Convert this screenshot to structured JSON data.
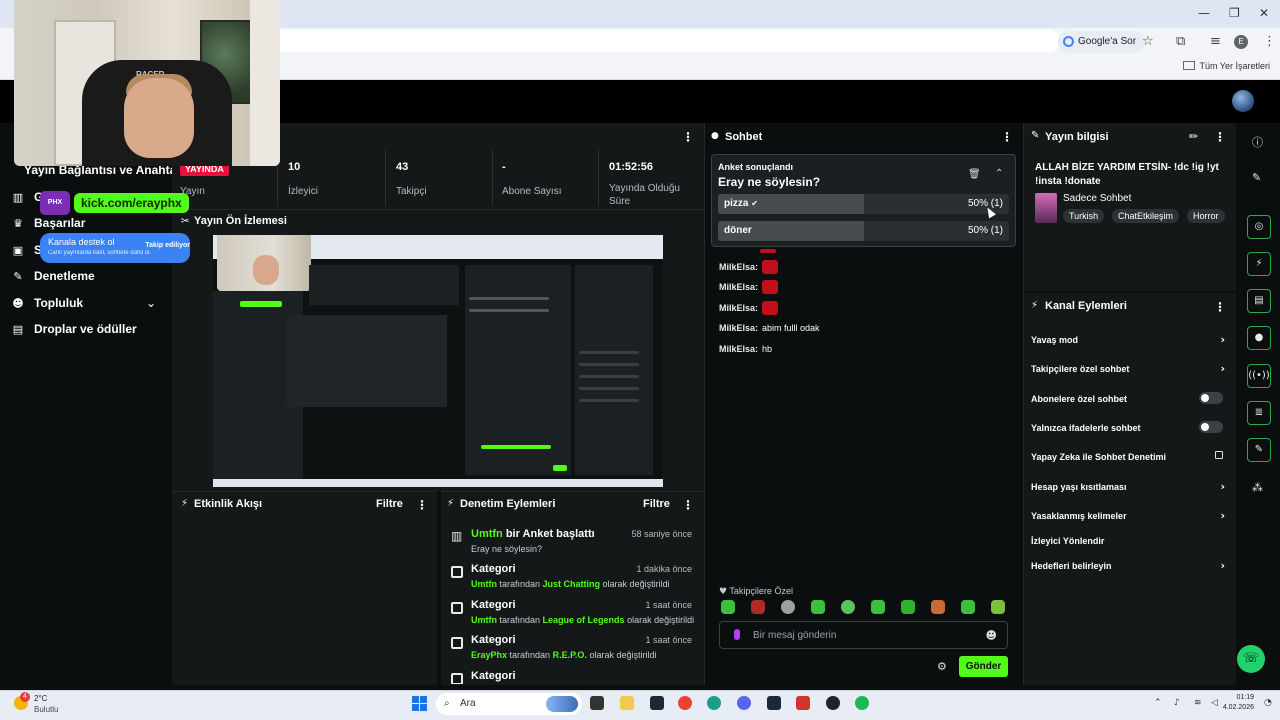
{
  "browser": {
    "google_pill": "Google'a Sor",
    "bookmarks_label": "Tüm Yer İşaretleri",
    "profile_initial": "E"
  },
  "webcam_overlay": {
    "chair_brand": "RACER",
    "kick_badge": "PHX",
    "kick_link": "kick.com/erayphx",
    "support_title": "Kanala destek ol",
    "support_sub": "Canlı yayınlarda katıl, sohbete dahil ol.",
    "support_action": "Takip ediliyor"
  },
  "sidebar": {
    "items": [
      {
        "label": "Yayın Bağlantısı ve Anahtarı",
        "icon": "key-icon"
      },
      {
        "label": "G",
        "icon": "chart-icon"
      },
      {
        "label": "Başarılar",
        "icon": "trophy-icon"
      },
      {
        "label": "S",
        "icon": "video-icon"
      },
      {
        "label": "Denetleme",
        "icon": "wrench-icon"
      },
      {
        "label": "Topluluk",
        "icon": "people-icon"
      },
      {
        "label": "Droplar ve ödüller",
        "icon": "gift-icon"
      }
    ]
  },
  "stats": {
    "status_badge": "YAYINDA",
    "status_label": "Yayın",
    "viewers_value": "10",
    "viewers_label": "İzleyici",
    "followers_value": "43",
    "followers_label": "Takipçi",
    "subs_value": "-",
    "subs_label": "Abone Sayısı",
    "uptime_value": "01:52:56",
    "uptime_label": "Yayında Olduğu Süre"
  },
  "preview": {
    "title": "Yayın Ön İzlemesi"
  },
  "activity_feed": {
    "title": "Etkinlik Akışı",
    "filter": "Filtre"
  },
  "mod_actions": {
    "title": "Denetim Eylemleri",
    "filter": "Filtre",
    "items": [
      {
        "title_user": "Umtfn",
        "title_rest": " bir Anket başlattı",
        "time": "58 saniye önce",
        "sub_plain": "Eray ne söylesin?",
        "icon": "chart-icon"
      },
      {
        "title": "Kategori",
        "time": "1 dakika önce",
        "sub_user": "Umtfn",
        "sub_mid": " tarafından ",
        "sub_value": "Just Chatting",
        "sub_end": " olarak değiştirildi",
        "icon": "category-icon"
      },
      {
        "title": "Kategori",
        "time": "1 saat önce",
        "sub_user": "Umtfn",
        "sub_mid": " tarafından ",
        "sub_value": "League of Legends",
        "sub_end": " olarak değiştirildi",
        "icon": "category-icon"
      },
      {
        "title": "Kategori",
        "time": "1 saat önce",
        "sub_user": "ErayPhx",
        "sub_mid": " tarafından ",
        "sub_value": "R.E.P.O.",
        "sub_end": " olarak değiştirildi",
        "icon": "category-icon"
      },
      {
        "title": "Kategori",
        "icon": "category-icon"
      }
    ]
  },
  "chat": {
    "title": "Sohbet",
    "poll": {
      "caption": "Anket sonuçlandı",
      "question": "Eray ne söylesin?",
      "options": [
        {
          "name": "pizza",
          "percent": "50% (1)",
          "share": 0.5,
          "winner": true
        },
        {
          "name": "döner",
          "percent": "50% (1)",
          "share": 0.5,
          "winner": false
        }
      ]
    },
    "messages": [
      {
        "user": "",
        "text": "",
        "emote": true
      },
      {
        "user": "MilkElsa:",
        "text": "",
        "emote": true
      },
      {
        "user": "MilkElsa:",
        "text": "",
        "emote": true
      },
      {
        "user": "MilkElsa:",
        "text": "",
        "emote": true
      },
      {
        "user": "MilkElsa:",
        "text": "abim fulll odak",
        "emote": false
      },
      {
        "user": "MilkElsa:",
        "text": "hb",
        "emote": false
      }
    ],
    "followers_only": "Takipçilere Özel",
    "message_placeholder": "Bir mesaj gönderin",
    "send_label": "Gönder"
  },
  "stream_info": {
    "title_label": "Yayın bilgisi",
    "stream_title": "ALLAH BİZE YARDIM ETSİN- !dc !ig !yt !insta !donate",
    "category": "Sadece Sohbet",
    "tags": [
      "Turkish",
      "ChatEtkileşim",
      "Horror"
    ]
  },
  "channel_actions": {
    "title": "Kanal Eylemleri",
    "rows": [
      {
        "label": "Yavaş mod",
        "control": "arrow"
      },
      {
        "label": "Takipçilere özel sohbet",
        "control": "arrow"
      },
      {
        "label": "Abonelere özel sohbet",
        "control": "toggle",
        "on": false
      },
      {
        "label": "Yalnızca ifadelerle sohbet",
        "control": "toggle",
        "on": false
      },
      {
        "label": "Yapay Zeka ile Sohbet Denetimi",
        "control": "external"
      },
      {
        "label": "Hesap yaşı kısıtlaması",
        "control": "arrow"
      },
      {
        "label": "Yasaklanmış kelimeler",
        "control": "arrow"
      },
      {
        "label": "İzleyici Yönlendir",
        "control": "none"
      },
      {
        "label": "Hedefleri belirleyin",
        "control": "arrow"
      }
    ]
  },
  "taskbar": {
    "weather_badge": "4",
    "temperature": "2°C",
    "condition": "Bulutlu",
    "search_text": "Ara",
    "time": "01:19",
    "date": "4.02.2026"
  }
}
